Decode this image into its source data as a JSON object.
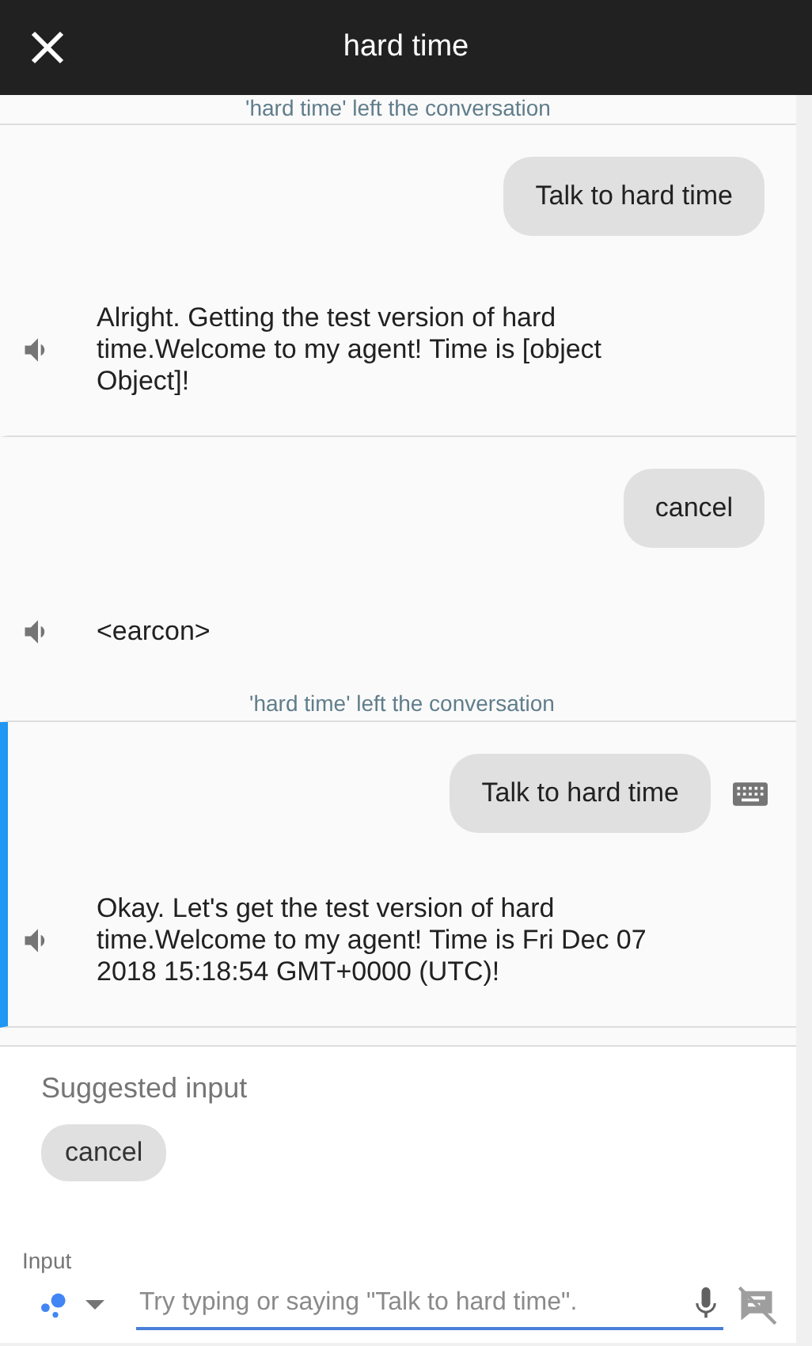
{
  "header": {
    "title": "hard time"
  },
  "previous_status": "'hard time' left the conversation",
  "turns": [
    {
      "selected": false,
      "user": {
        "text": "Talk to hard time",
        "typed": false
      },
      "reply": {
        "text": "Alright. Getting the test version of hard time.Welcome to my agent! Time is [object Object]!"
      }
    },
    {
      "selected": false,
      "user": {
        "text": "cancel",
        "typed": false
      },
      "reply": {
        "text": "<earcon>"
      },
      "status": "'hard time' left the conversation"
    },
    {
      "selected": true,
      "user": {
        "text": "Talk to hard time",
        "typed": true
      },
      "reply": {
        "text": "Okay. Let's get the test version of hard time.Welcome to my agent! Time is Fri Dec 07 2018 15:18:54 GMT+0000 (UTC)!"
      }
    }
  ],
  "suggestions": {
    "title": "Suggested input",
    "chips": [
      "cancel"
    ]
  },
  "input": {
    "label": "Input",
    "placeholder": "Try typing or saying \"Talk to hard time\"."
  }
}
